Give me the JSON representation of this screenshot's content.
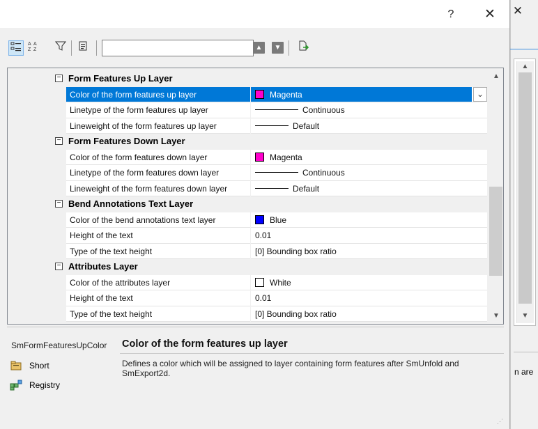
{
  "background_window": {
    "close_glyph": "✕",
    "text": "n are",
    "scroll_up_glyph": "▲",
    "scroll_down_glyph": "▼"
  },
  "titlebar": {
    "help_glyph": "?",
    "close_glyph": "✕"
  },
  "toolbar": {
    "search_value": "",
    "up_glyph": "▲",
    "down_glyph": "▼"
  },
  "grid": {
    "categories": [
      {
        "label": "Form Features Up Layer",
        "toggle": "−",
        "properties": [
          {
            "name": "Color of the form features up layer",
            "value": "Magenta",
            "swatch": "#ff00cc",
            "selected": true
          },
          {
            "name": "Linetype of the form features up layer",
            "value": "Continuous",
            "line": "long"
          },
          {
            "name": "Lineweight of the form features up layer",
            "value": "Default",
            "line": "short"
          }
        ]
      },
      {
        "label": "Form Features Down Layer",
        "toggle": "−",
        "properties": [
          {
            "name": "Color of the form features down layer",
            "value": "Magenta",
            "swatch": "#ff00cc"
          },
          {
            "name": "Linetype of the form features down layer",
            "value": "Continuous",
            "line": "long"
          },
          {
            "name": "Lineweight of the form features down layer",
            "value": "Default",
            "line": "short"
          }
        ]
      },
      {
        "label": "Bend Annotations Text Layer",
        "toggle": "−",
        "properties": [
          {
            "name": "Color of the bend annotations text layer",
            "value": "Blue",
            "swatch": "#0000ff"
          },
          {
            "name": "Height of the text",
            "value": "0.01"
          },
          {
            "name": "Type of the text height",
            "value": "[0] Bounding box ratio"
          }
        ]
      },
      {
        "label": "Attributes Layer",
        "toggle": "−",
        "properties": [
          {
            "name": "Color of the attributes layer",
            "value": "White",
            "swatch": "#ffffff"
          },
          {
            "name": "Height of the text",
            "value": "0.01"
          },
          {
            "name": "Type of the text height",
            "value": "[0] Bounding box ratio"
          }
        ]
      }
    ],
    "dropdown_glyph": "⌄",
    "scroll_up_glyph": "▲",
    "scroll_down_glyph": "▼"
  },
  "description": {
    "key": "SmFormFeaturesUpColor",
    "title": "Color of the form features up layer",
    "text": "Defines a color which will be assigned to layer containing form features after SmUnfold and SmExport2d.",
    "short_label": "Short",
    "registry_label": "Registry"
  }
}
